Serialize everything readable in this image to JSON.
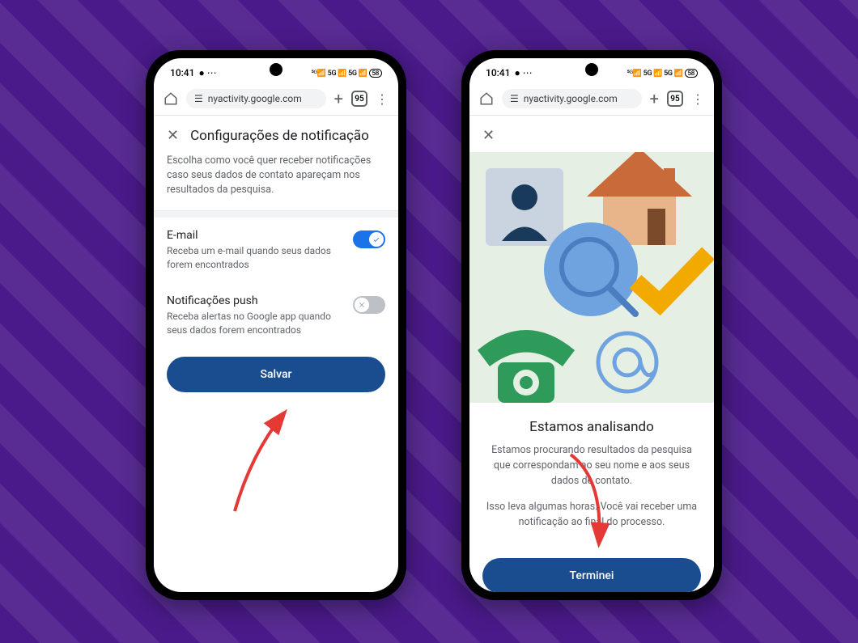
{
  "statusBar": {
    "time": "10:41",
    "network": "5G ⊪ 5G ⊪",
    "battery": "58"
  },
  "browser": {
    "url": "nyactivity.google.com",
    "tabCount": "95"
  },
  "phone1": {
    "title": "Configurações de notificação",
    "description": "Escolha como você quer receber notificações caso seus dados de contato apareçam nos resultados da pesquisa.",
    "email": {
      "title": "E-mail",
      "sub": "Receba um e-mail quando seus dados forem encontrados"
    },
    "push": {
      "title": "Notificações push",
      "sub": "Receba alertas no Google app quando seus dados forem encontrados"
    },
    "saveButton": "Salvar"
  },
  "phone2": {
    "title": "Estamos analisando",
    "text1": "Estamos procurando resultados da pesquisa que correspondam ao seu nome e aos seus dados de contato.",
    "text2": "Isso leva algumas horas. Você vai receber uma notificação ao final do processo.",
    "doneButton": "Terminei"
  }
}
